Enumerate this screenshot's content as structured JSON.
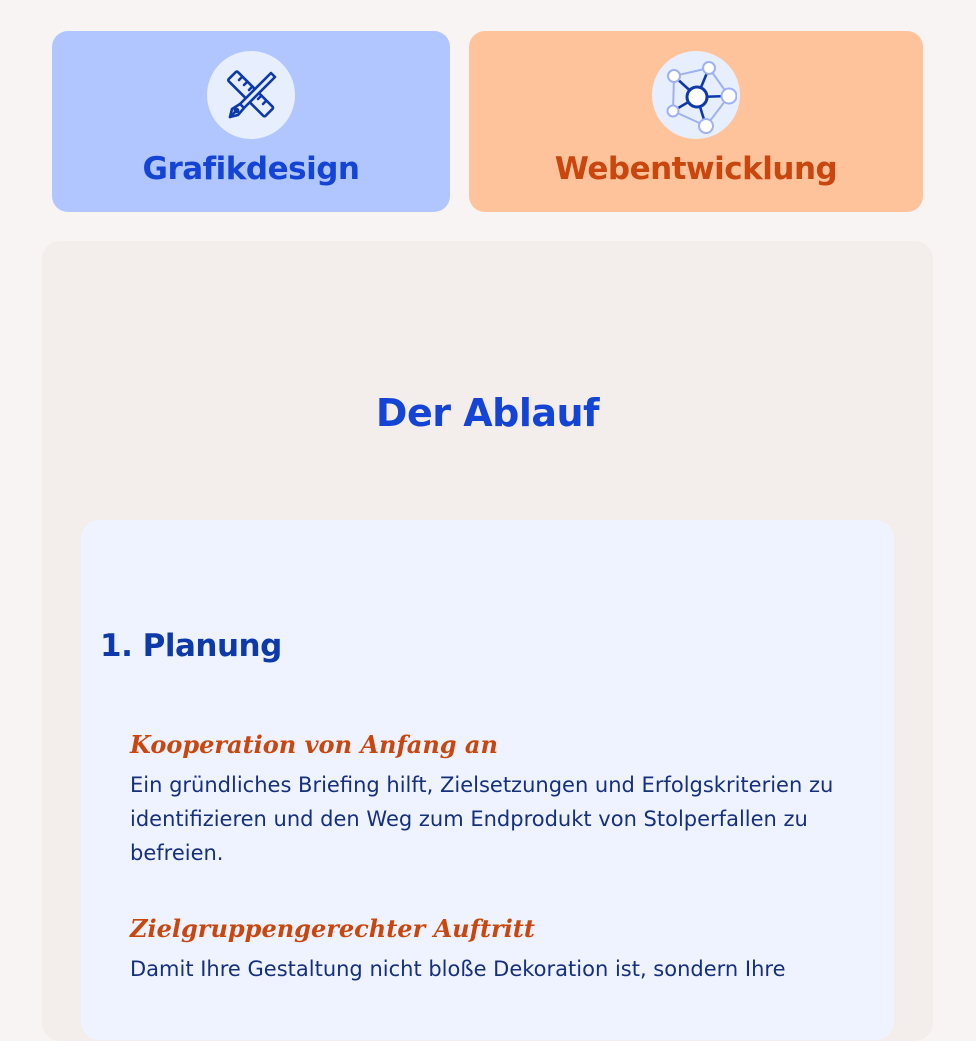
{
  "service_cards": [
    {
      "title": "Grafikdesign",
      "icon": "pen-ruler-icon",
      "bg_color": "#b1c6ff",
      "text_color": "#1444d6"
    },
    {
      "title": "Webentwicklung",
      "icon": "network-nodes-icon",
      "bg_color": "#ffc39c",
      "text_color": "#c9470e"
    }
  ],
  "process": {
    "title": "Der Ablauf",
    "steps": [
      {
        "heading": "1. Planung",
        "items": [
          {
            "title": "Kooperation von Anfang an",
            "text": "Ein gründliches Briefing hilft, Zielsetzungen und Erfolgskriterien zu identifizieren und den Weg zum Endprodukt von Stolperfallen zu befreien."
          },
          {
            "title": "Zielgruppengerechter Auftritt",
            "text": "Damit Ihre Gestaltung nicht bloße Dekoration ist, sondern Ihre"
          }
        ]
      }
    ]
  }
}
